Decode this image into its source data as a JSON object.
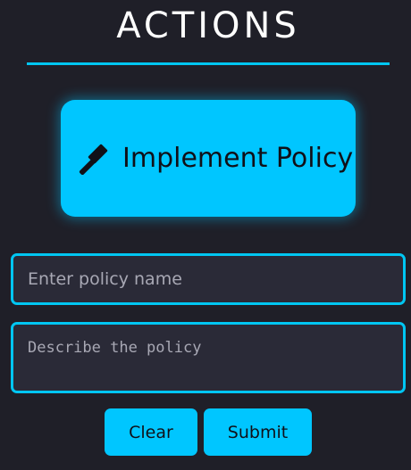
{
  "header": {
    "title": "ACTIONS"
  },
  "primary_action": {
    "label": "Implement Policy",
    "icon": "gavel-icon"
  },
  "form": {
    "policy_name": {
      "value": "",
      "placeholder": "Enter policy name"
    },
    "policy_description": {
      "value": "",
      "placeholder": "Describe the policy"
    },
    "clear_label": "Clear",
    "submit_label": "Submit"
  },
  "colors": {
    "background": "#1f1f28",
    "accent": "#00c6ff",
    "field_background": "#2a2a37",
    "title_text": "#ffffff",
    "button_text": "#101018"
  }
}
